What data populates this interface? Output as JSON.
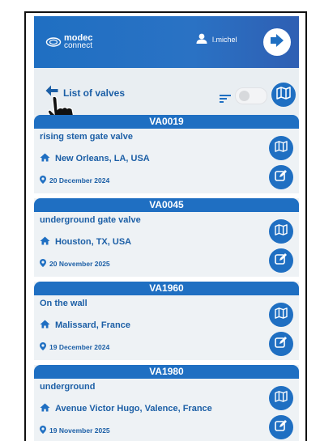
{
  "header": {
    "logo_line1": "modec",
    "logo_line2": "connect",
    "username": "l.michel"
  },
  "subheader": {
    "back_label": "List of valves"
  },
  "valves": [
    {
      "id": "VA0019",
      "type": "rising stem gate valve",
      "location": "New Orleans, LA, USA",
      "date": "20 December 2024"
    },
    {
      "id": "VA0045",
      "type": "underground gate valve",
      "location": "Houston, TX, USA",
      "date": "20 November 2025"
    },
    {
      "id": "VA1960",
      "type": "On the wall",
      "location": "Malissard, France",
      "date": "19 December 2024"
    },
    {
      "id": "VA1980",
      "type": "underground",
      "location": "Avenue Victor Hugo, Valence, France",
      "date": "19 November 2025"
    }
  ],
  "colors": {
    "brand_blue": "#1f6fc2",
    "text_blue": "#1c5fa6",
    "subbar_bg": "#e9eef2"
  },
  "icons": [
    "user-icon",
    "logout-icon",
    "back-arrow-icon",
    "pointer-hand-icon",
    "sort-icon",
    "map-icon",
    "edit-icon",
    "home-icon",
    "location-pin-icon"
  ]
}
